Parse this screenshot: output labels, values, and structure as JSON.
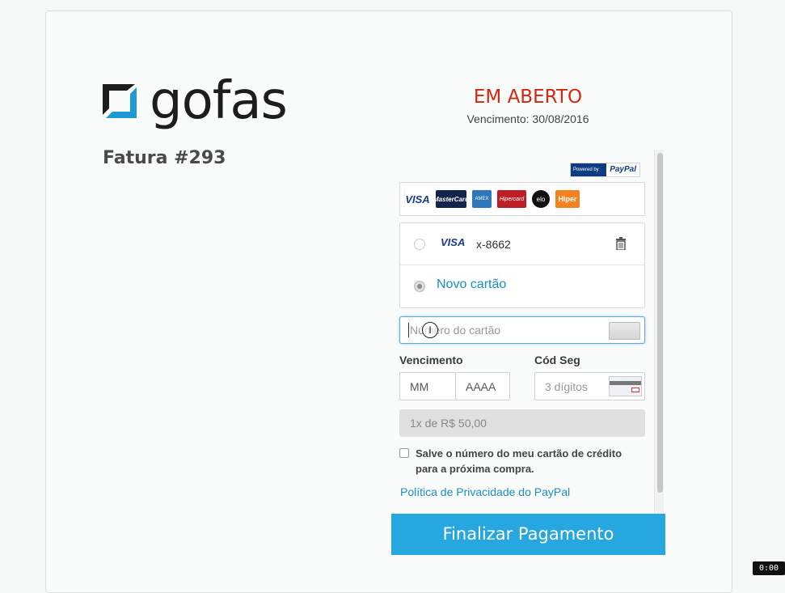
{
  "header": {
    "logo_text": "gofas",
    "invoice_title": "Fatura #293",
    "status": "EM ABERTO",
    "due_date": "Vencimento: 30/08/2016"
  },
  "paypal_badge": {
    "left": "Powered by",
    "right": "PayPal"
  },
  "brands": [
    "VISA",
    "MasterCard",
    "AMEX",
    "Hipercard",
    "elo",
    "Hiper"
  ],
  "saved_cards": [
    {
      "brand": "VISA",
      "number": "x-8662"
    }
  ],
  "new_card_label": "Novo cartão",
  "form": {
    "card_number_placeholder": "Número do cartão",
    "expiry_label": "Vencimento",
    "month_placeholder": "MM",
    "year_placeholder": "AAAA",
    "cvv_label": "Cód Seg",
    "cvv_placeholder": "3 dígitos",
    "installments": "1x de R$ 50,00",
    "save_card_label": "Salve o número do meu cartão de crédito para a próxima compra.",
    "privacy_link": "Política de Privacidade do PayPal",
    "submit_label": "Finalizar Pagamento"
  },
  "timer": "0:00",
  "colors": {
    "status": "#d3270f",
    "accent": "#26a7df",
    "link": "#1a8fc7",
    "logo_mark": "#1d9ad6"
  }
}
